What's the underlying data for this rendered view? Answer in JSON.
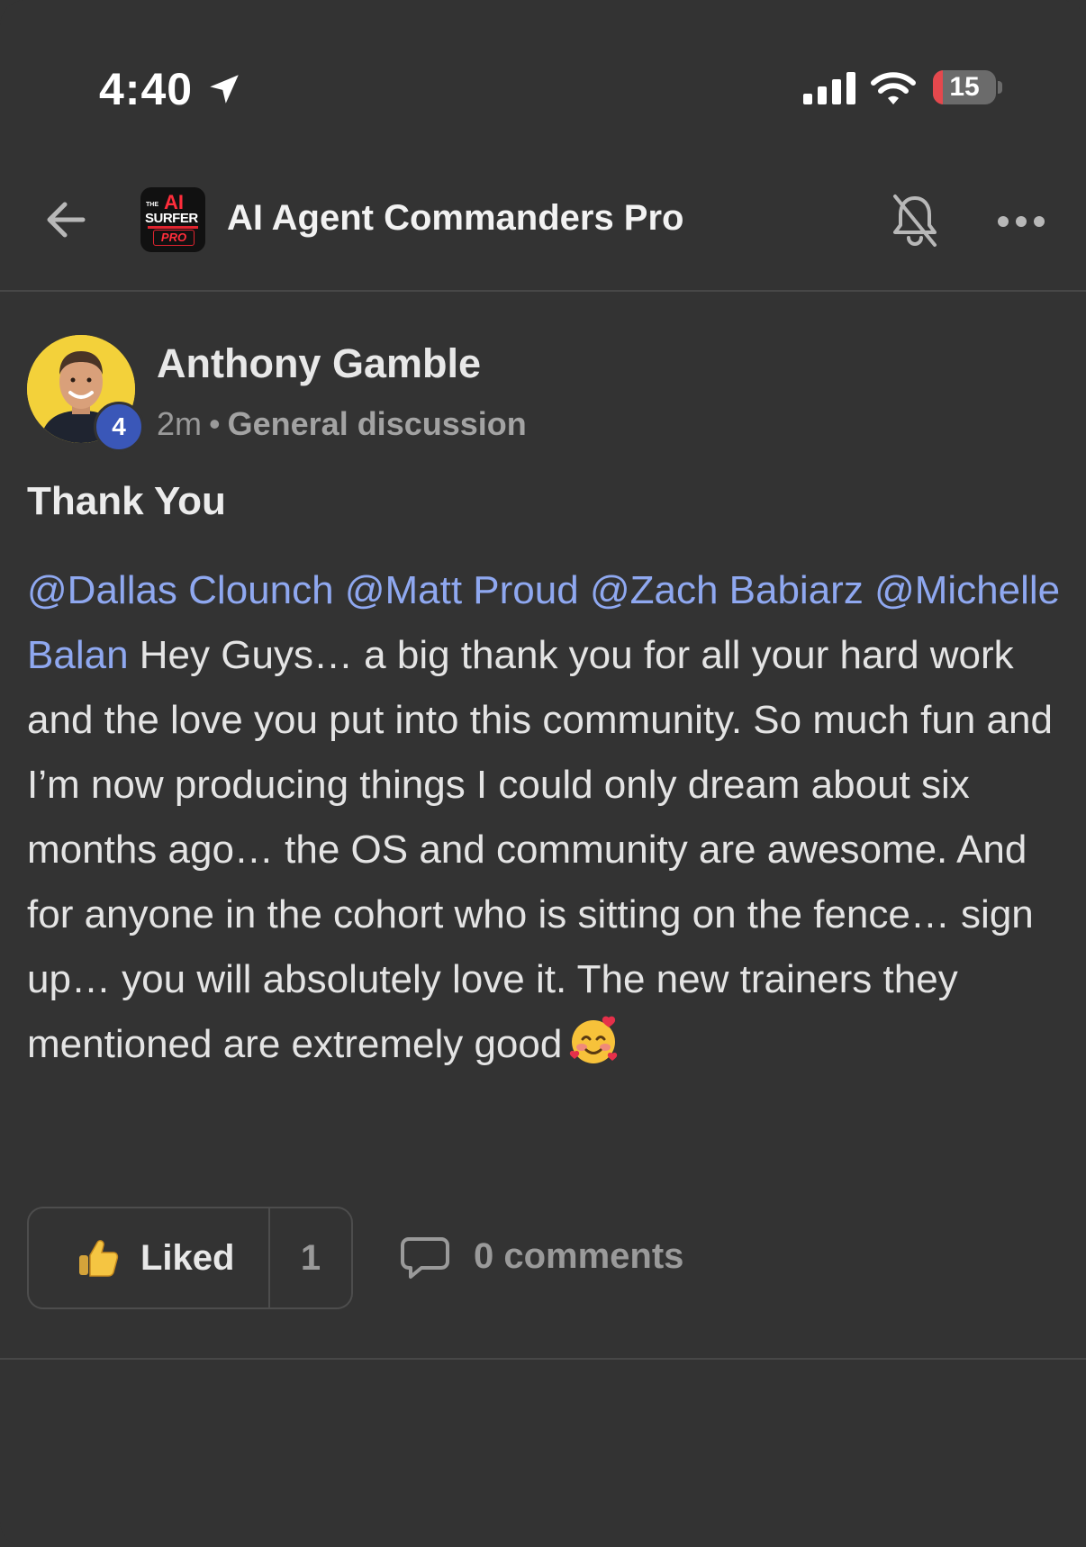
{
  "status_bar": {
    "time": "4:40",
    "battery_level": "15",
    "battery_percent": 15,
    "battery_color": "#e5484d",
    "icons": [
      "location-arrow-icon",
      "cellular-signal-icon",
      "wifi-icon",
      "battery-charging-icon"
    ]
  },
  "header": {
    "group_title": "AI Agent Commanders Pro",
    "logo": {
      "small_text": "THE",
      "big_text": "AI",
      "word": "SURFER",
      "badge": "PRO"
    },
    "icons": [
      "back-arrow-icon",
      "bell-off-icon",
      "more-dots-icon"
    ]
  },
  "post": {
    "author": "Anthony Gamble",
    "level": "4",
    "time_ago": "2m",
    "separator": "•",
    "category": "General discussion",
    "title": "Thank You",
    "mentions": [
      "@Dallas Clounch",
      "@Matt Proud",
      "@Zach Babiarz",
      "@Michelle Balan"
    ],
    "body_text": "Hey Guys… a big thank you for all your hard work and the love you put into this community. So much fun and I’m now producing things I could only dream about six months ago… the OS and community are awesome. And for anyone in the cohort who is sitting on the fence… sign up… you will absolutely love it. The new trainers they mentioned are extremely good",
    "emoji": "smiling-face-with-hearts-icon"
  },
  "actions": {
    "liked_label": "Liked",
    "like_count": "1",
    "comments_label": "0 comments"
  },
  "colors": {
    "background": "#333333",
    "mention": "#8fa8f0",
    "level_badge": "#3a57b8",
    "avatar_bg": "#f3d13a"
  }
}
